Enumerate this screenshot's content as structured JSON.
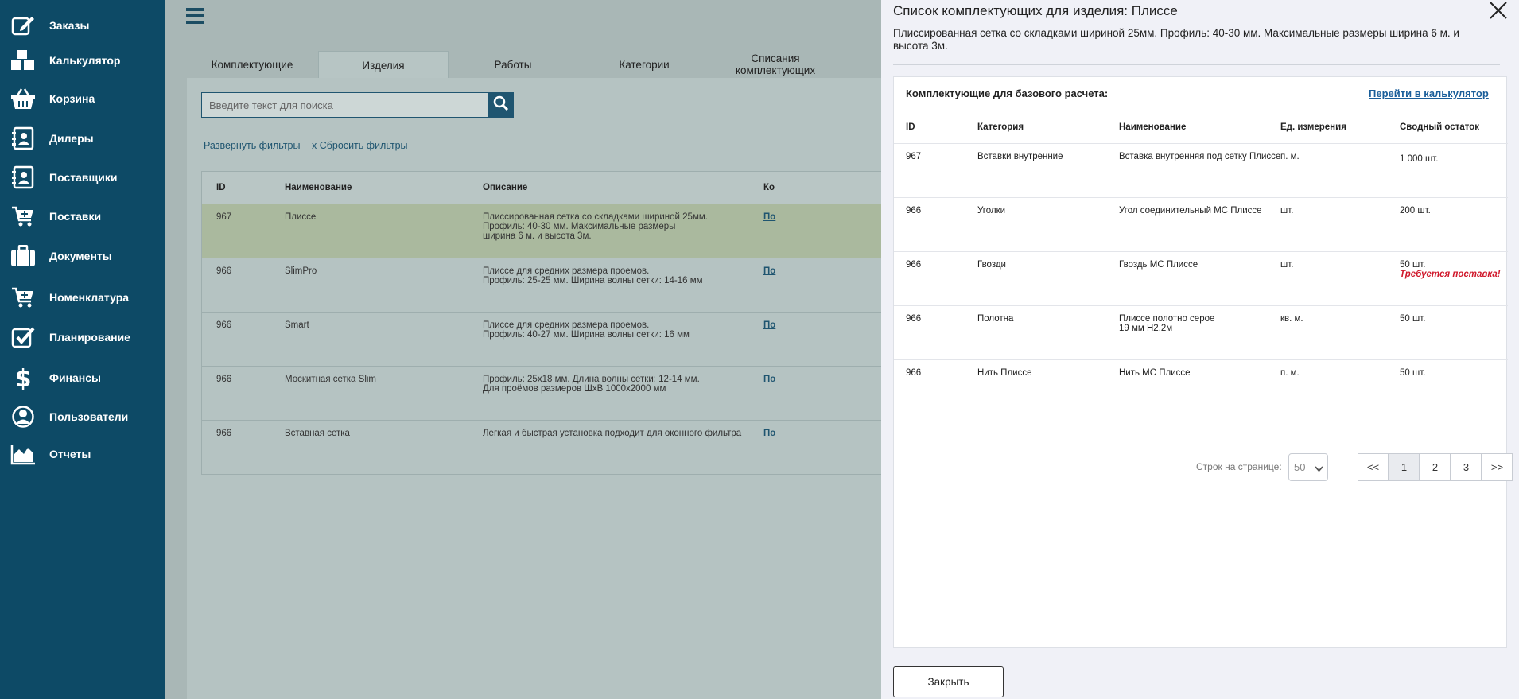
{
  "sidebar": {
    "items": [
      {
        "label": "Заказы",
        "icon": "edit-icon"
      },
      {
        "label": "Калькулятор",
        "icon": "boxes-icon"
      },
      {
        "label": "Корзина",
        "icon": "basket-icon"
      },
      {
        "label": "Дилеры",
        "icon": "contact-card-icon"
      },
      {
        "label": "Поставщики",
        "icon": "contact-card-icon"
      },
      {
        "label": "Поставки",
        "icon": "cart-plus-icon"
      },
      {
        "label": "Документы",
        "icon": "briefcase-icon"
      },
      {
        "label": "Номенклатура",
        "icon": "cart-plus-icon"
      },
      {
        "label": "Планирование",
        "icon": "checkbox-icon"
      },
      {
        "label": "Финансы",
        "icon": "dollar-icon"
      },
      {
        "label": "Пользователи",
        "icon": "user-circle-icon"
      },
      {
        "label": "Отчеты",
        "icon": "area-chart-icon"
      }
    ]
  },
  "main": {
    "tabs": [
      "Комплектующие",
      "Изделия",
      "Работы",
      "Категории",
      "Списания комплектующих"
    ],
    "active_tab": "Изделия",
    "search_placeholder": "Введите текст для поиска",
    "expand_filters": "Развернуть фильтры",
    "reset_filters": "x Сбросить фильтры",
    "columns": [
      "ID",
      "Наименование",
      "Описание",
      "Ко"
    ],
    "rows": [
      {
        "id": "967",
        "name": "Плиссе",
        "desc": [
          "Плиссированная сетка со складками шириной 25мм.",
          "Профиль: 40-30 мм. Максимальные размеры",
          "ширина 6 м. и высота 3м."
        ],
        "link": "По"
      },
      {
        "id": "966",
        "name": "SlimPro",
        "desc": [
          "Плиссе для средних размера проемов.",
          "Профиль: 25-25 мм. Ширина волны сетки: 14-16 мм"
        ],
        "link": "По"
      },
      {
        "id": "966",
        "name": "Smart",
        "desc": [
          "Плиссе для средних размера проемов.",
          "Профиль: 40-27 мм. Ширина волны сетки: 16 мм"
        ],
        "link": "По"
      },
      {
        "id": "966",
        "name": "Москитная сетка Slim",
        "desc": [
          "Профиль: 25х18 мм. Длина волны сетки: 12-14 мм.",
          "Для проёмов размеров ШхВ 1000х2000 мм"
        ],
        "link": "По"
      },
      {
        "id": "966",
        "name": "Вставная сетка",
        "desc": [
          "Легкая и быстрая установка подходит для оконного фильтра"
        ],
        "link": "По"
      }
    ]
  },
  "panel": {
    "title": "Список комплектующих для изделия: Плиссе",
    "description": "Плиссированная сетка со складками шириной 25мм. Профиль: 40-30 мм. Максимальные размеры ширина 6 м. и высота 3м.",
    "card_title": "Комплектующие для базового расчета:",
    "calc_link": "Перейти в калькулятор",
    "columns": [
      "ID",
      "Категория",
      "Наименование",
      "Ед. измерения",
      "Сводный остаток"
    ],
    "rows": [
      {
        "id": "967",
        "category": "Вставки внутренние",
        "name": [
          "Вставка внутренняя под сетку Плиссе"
        ],
        "unit": "п. м.",
        "stock": "1 000 шт.",
        "warning": ""
      },
      {
        "id": "966",
        "category": "Уголки",
        "name": [
          "Угол соединительный МС Плиссе"
        ],
        "unit": "шт.",
        "stock": "200 шт.",
        "warning": ""
      },
      {
        "id": "966",
        "category": "Гвозди",
        "name": [
          "Гвоздь МС Плиссе"
        ],
        "unit": "шт.",
        "stock": "50 шт.",
        "warning": "Требуется поставка!"
      },
      {
        "id": "966",
        "category": "Полотна",
        "name": [
          "Плиссе полотно серое",
          "19 мм H2.2м"
        ],
        "unit": "кв. м.",
        "stock": "50 шт.",
        "warning": ""
      },
      {
        "id": "966",
        "category": "Нить Плиссе",
        "name": [
          "Нить МС Плиссе"
        ],
        "unit": "п. м.",
        "stock": "50 шт.",
        "warning": ""
      }
    ],
    "rows_per_page_label": "Строк на странице:",
    "rows_per_page": "50",
    "pages": [
      "<<",
      "1",
      "2",
      "3",
      ">>"
    ],
    "current_page": "1",
    "close_button": "Закрыть"
  }
}
